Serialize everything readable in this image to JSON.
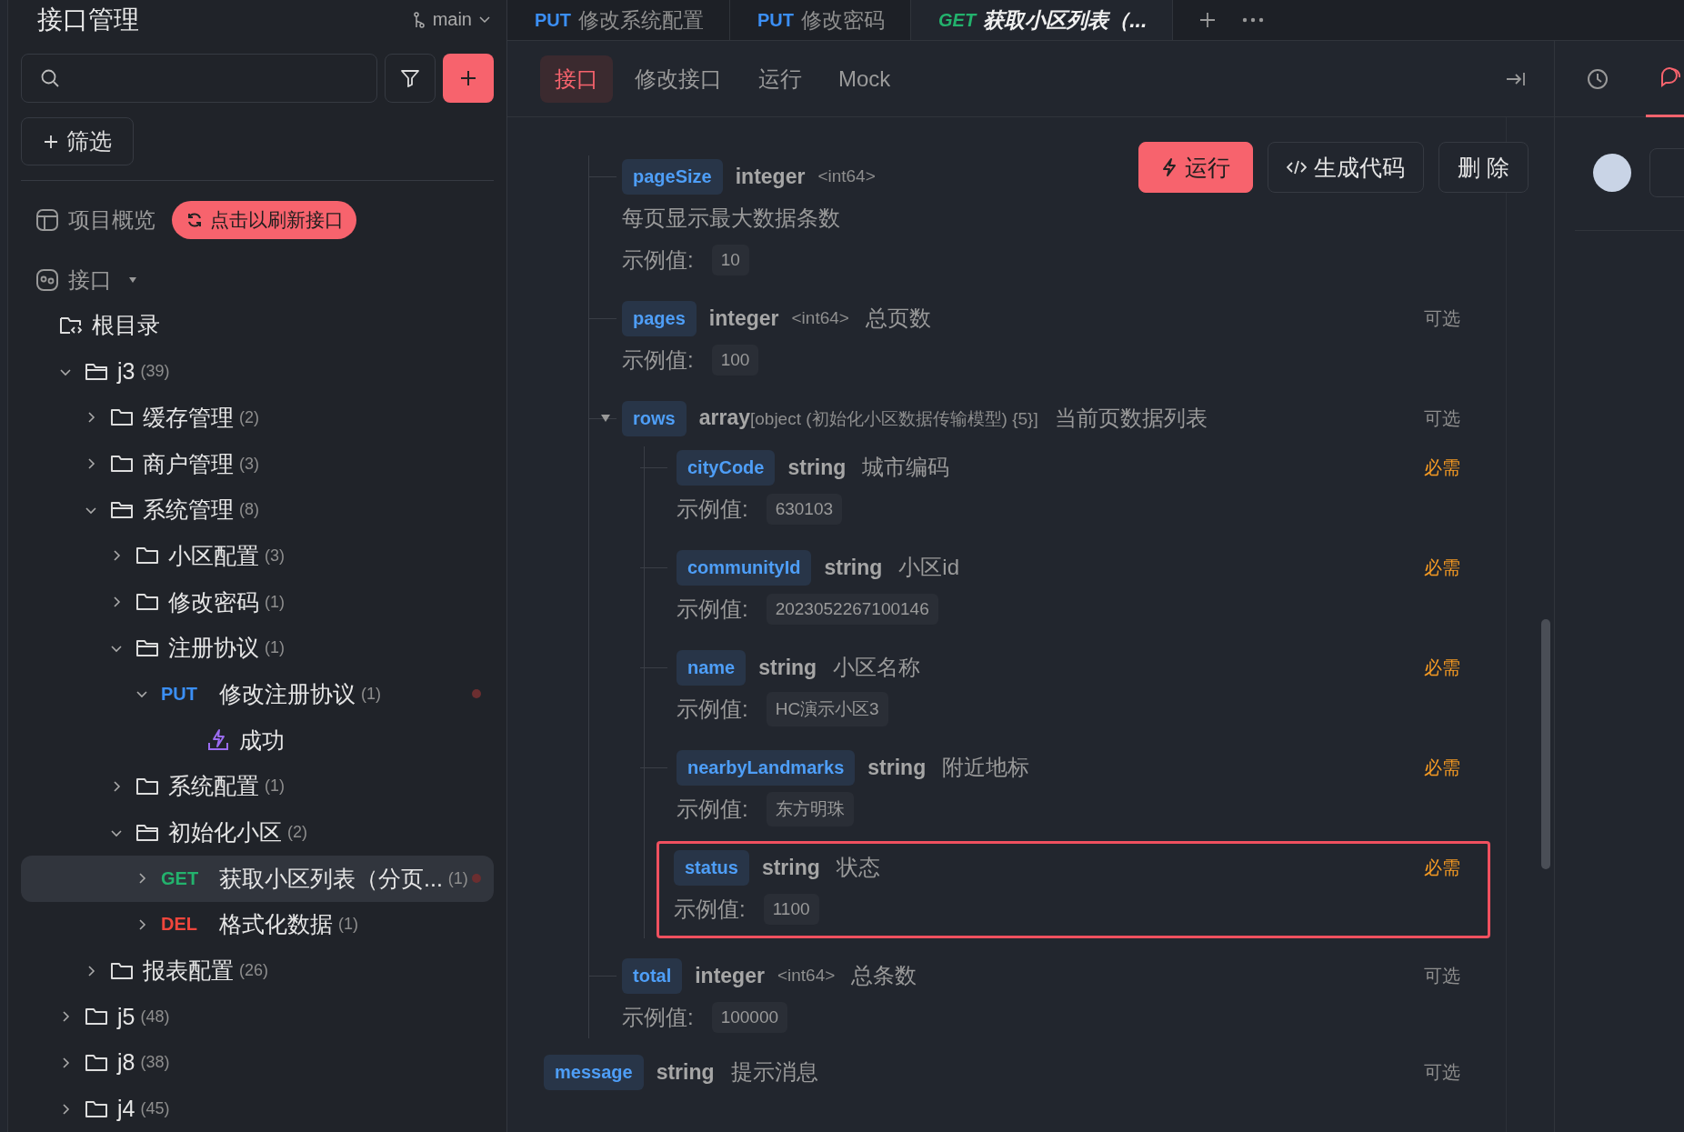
{
  "sidebar": {
    "title": "接口管理",
    "branch": "main",
    "filter_button": "筛选",
    "overview": "项目概览",
    "refresh_button": "点击以刷新接口",
    "section": "接口",
    "tree": [
      {
        "kind": "root",
        "label": "根目录",
        "children": [
          {
            "kind": "folder",
            "label": "j3",
            "count": "(39)",
            "expanded": true,
            "children": [
              {
                "kind": "folder",
                "label": "缓存管理",
                "count": "(2)",
                "expanded": false
              },
              {
                "kind": "folder",
                "label": "商户管理",
                "count": "(3)",
                "expanded": false
              },
              {
                "kind": "folder",
                "label": "系统管理",
                "count": "(8)",
                "expanded": true,
                "children": [
                  {
                    "kind": "folder",
                    "label": "小区配置",
                    "count": "(3)",
                    "expanded": false
                  },
                  {
                    "kind": "folder",
                    "label": "修改密码",
                    "count": "(1)",
                    "expanded": false
                  },
                  {
                    "kind": "folder",
                    "label": "注册协议",
                    "count": "(1)",
                    "expanded": true,
                    "children": [
                      {
                        "kind": "endpoint",
                        "method": "PUT",
                        "label": "修改注册协议",
                        "count": "(1)",
                        "expanded": true,
                        "selected": false,
                        "modified": true,
                        "children": [
                          {
                            "kind": "example",
                            "label": "成功"
                          }
                        ]
                      }
                    ]
                  },
                  {
                    "kind": "folder",
                    "label": "系统配置",
                    "count": "(1)",
                    "expanded": false
                  },
                  {
                    "kind": "folder",
                    "label": "初始化小区",
                    "count": "(2)",
                    "expanded": true,
                    "children": [
                      {
                        "kind": "endpoint",
                        "method": "GET",
                        "label": "获取小区列表（分页...",
                        "count": "(1)",
                        "expanded": false,
                        "selected": true,
                        "modified": true
                      },
                      {
                        "kind": "endpoint",
                        "method": "DEL",
                        "label": "格式化数据",
                        "count": "(1)",
                        "expanded": false,
                        "selected": false,
                        "modified": false
                      }
                    ]
                  }
                ]
              },
              {
                "kind": "folder",
                "label": "报表配置",
                "count": "(26)",
                "expanded": false
              }
            ]
          },
          {
            "kind": "folder",
            "label": "j5",
            "count": "(48)",
            "expanded": false
          },
          {
            "kind": "folder",
            "label": "j8",
            "count": "(38)",
            "expanded": false
          },
          {
            "kind": "folder",
            "label": "j4",
            "count": "(45)",
            "expanded": false
          }
        ]
      }
    ]
  },
  "tabs": [
    {
      "method": "PUT",
      "label": "修改系统配置",
      "selected": false
    },
    {
      "method": "PUT",
      "label": "修改密码",
      "selected": false
    },
    {
      "method": "GET",
      "label": "获取小区列表（...",
      "selected": true
    }
  ],
  "subtabs": [
    {
      "label": "接口",
      "selected": true
    },
    {
      "label": "修改接口",
      "selected": false
    },
    {
      "label": "运行",
      "selected": false
    },
    {
      "label": "Mock",
      "selected": false
    }
  ],
  "actions": [
    {
      "kind": "run",
      "label": "运行"
    },
    {
      "kind": "code",
      "label": "生成代码"
    },
    {
      "kind": "delete",
      "label": "删 除"
    }
  ],
  "fields": [
    {
      "name": "pageSize",
      "type": "integer",
      "format": "<int64>",
      "note": "每页显示最大数据条数",
      "example_label": "示例值:",
      "example": "10"
    },
    {
      "name": "pages",
      "type": "integer",
      "format": "<int64>",
      "description": "总页数",
      "example_label": "示例值:",
      "example": "100",
      "requirement": "可选",
      "required": false
    },
    {
      "name": "rows",
      "type": "array",
      "type_detail": "[object (初始化小区数据传输模型) {5}]",
      "description": "当前页数据列表",
      "requirement": "可选",
      "required": false,
      "expanded": true,
      "children": [
        {
          "name": "cityCode",
          "type": "string",
          "description": "城市编码",
          "example_label": "示例值:",
          "example": "630103",
          "requirement": "必需",
          "required": true,
          "highlighted": false
        },
        {
          "name": "communityId",
          "type": "string",
          "description": "小区id",
          "example_label": "示例值:",
          "example": "2023052267100146",
          "requirement": "必需",
          "required": true,
          "highlighted": false
        },
        {
          "name": "name",
          "type": "string",
          "description": "小区名称",
          "example_label": "示例值:",
          "example": "HC演示小区3",
          "requirement": "必需",
          "required": true,
          "highlighted": false
        },
        {
          "name": "nearbyLandmarks",
          "type": "string",
          "description": "附近地标",
          "example_label": "示例值:",
          "example": "东方明珠",
          "requirement": "必需",
          "required": true,
          "highlighted": false
        },
        {
          "name": "status",
          "type": "string",
          "description": "状态",
          "example_label": "示例值:",
          "example": "1100",
          "requirement": "必需",
          "required": true,
          "highlighted": true
        }
      ]
    },
    {
      "name": "total",
      "type": "integer",
      "format": "<int64>",
      "description": "总条数",
      "example_label": "示例值:",
      "example": "100000",
      "requirement": "可选",
      "required": false
    }
  ],
  "trailing_fields": [
    {
      "name": "message",
      "type": "string",
      "description": "提示消息",
      "requirement": "可选",
      "required": false
    }
  ]
}
